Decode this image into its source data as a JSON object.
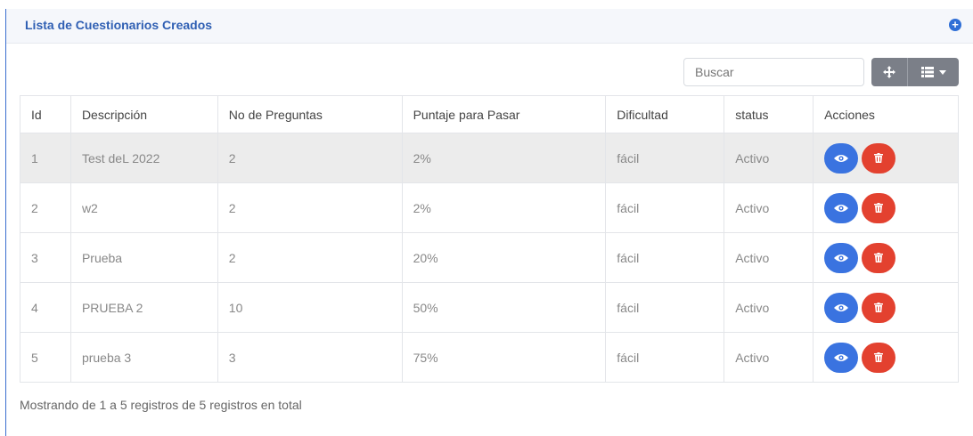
{
  "header": {
    "title": "Lista de Cuestionarios Creados"
  },
  "toolbar": {
    "search_placeholder": "Buscar"
  },
  "table": {
    "columns": [
      "Id",
      "Descripción",
      "No de Preguntas",
      "Puntaje para Pasar",
      "Dificultad",
      "status",
      "Acciones"
    ],
    "rows": [
      {
        "id": "1",
        "descripcion": "Test deL 2022",
        "preguntas": "2",
        "puntaje": "2%",
        "dificultad": "fácil",
        "status": "Activo"
      },
      {
        "id": "2",
        "descripcion": "w2",
        "preguntas": "2",
        "puntaje": "2%",
        "dificultad": "fácil",
        "status": "Activo"
      },
      {
        "id": "3",
        "descripcion": "Prueba",
        "preguntas": "2",
        "puntaje": "20%",
        "dificultad": "fácil",
        "status": "Activo"
      },
      {
        "id": "4",
        "descripcion": "PRUEBA 2",
        "preguntas": "10",
        "puntaje": "50%",
        "dificultad": "fácil",
        "status": "Activo"
      },
      {
        "id": "5",
        "descripcion": "prueba 3",
        "preguntas": "3",
        "puntaje": "75%",
        "dificultad": "fácil",
        "status": "Activo"
      }
    ]
  },
  "footer": {
    "summary": "Mostrando de 1 a 5 registros de 5 registros en total"
  },
  "icons": {
    "add": "plus-circle-icon",
    "move": "move-icon",
    "columns": "list-icon",
    "view": "eye-icon",
    "delete": "trash-icon"
  },
  "colors": {
    "accent": "#2f5fb3",
    "view_button": "#3a73e0",
    "delete_button": "#e3412f",
    "toolbar_button": "#7b7f88",
    "highlight_row": "#ececec"
  }
}
